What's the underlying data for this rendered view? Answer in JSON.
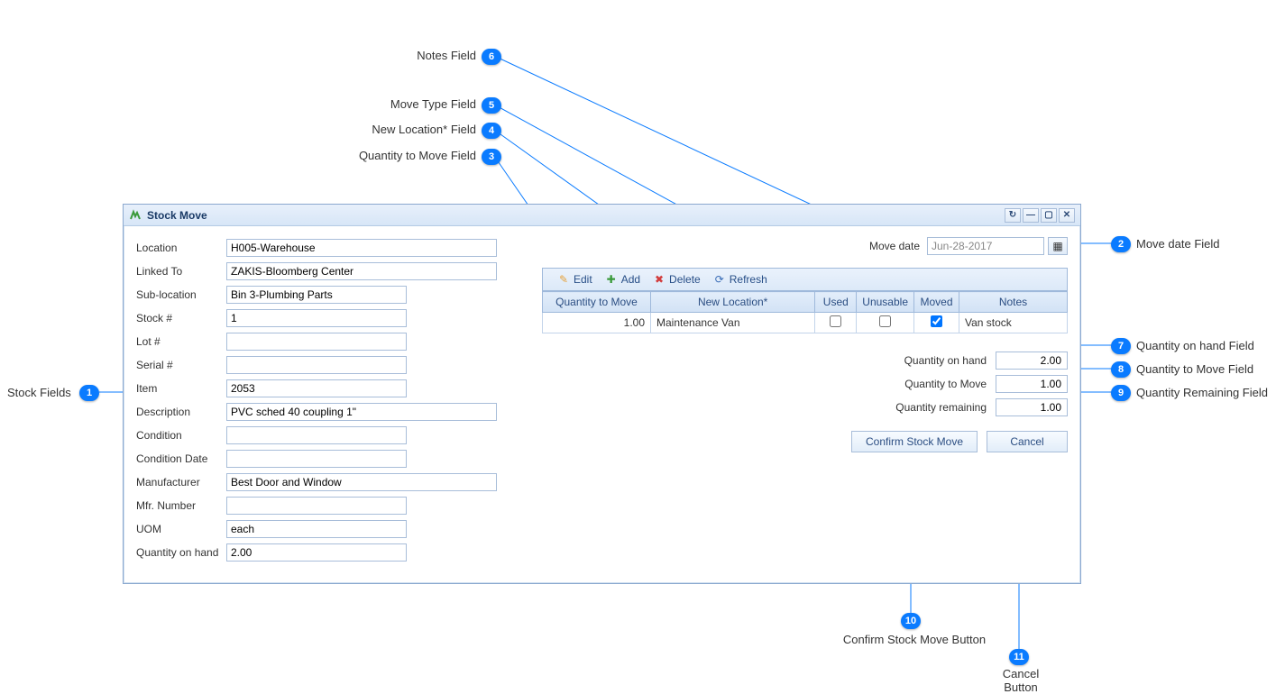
{
  "window": {
    "title": "Stock Move"
  },
  "icons": {
    "refresh": "↻",
    "minimize": "—",
    "maximize": "▢",
    "close": "✕",
    "edit_pencil": "✎",
    "add_plus": "✚",
    "delete_x": "✖",
    "refresh2": "⟳",
    "calendar": "▦"
  },
  "left": {
    "location_label": "Location",
    "location": "H005-Warehouse",
    "linkedto_label": "Linked To",
    "linkedto": "ZAKIS-Bloomberg Center",
    "subloc_label": "Sub-location",
    "subloc": "Bin 3-Plumbing Parts",
    "stock_label": "Stock #",
    "stock": "1",
    "lot_label": "Lot #",
    "lot": "",
    "serial_label": "Serial #",
    "serial": "",
    "item_label": "Item",
    "item": "2053",
    "desc_label": "Description",
    "desc": "PVC sched 40 coupling 1\"",
    "cond_label": "Condition",
    "cond": "",
    "conddate_label": "Condition Date",
    "conddate": "",
    "mfr_label": "Manufacturer",
    "mfr": "Best Door and Window",
    "mfrnum_label": "Mfr. Number",
    "mfrnum": "",
    "uom_label": "UOM",
    "uom": "each",
    "qoh_label": "Quantity on hand",
    "qoh": "2.00"
  },
  "movedate": {
    "label": "Move date",
    "value": "Jun-28-2017"
  },
  "toolbar": {
    "edit": "Edit",
    "add": "Add",
    "delete": "Delete",
    "refresh": "Refresh"
  },
  "grid": {
    "cols": {
      "qty": "Quantity to Move",
      "newloc": "New Location*",
      "used": "Used",
      "unusable": "Unusable",
      "moved": "Moved",
      "notes": "Notes"
    },
    "rows": [
      {
        "qty": "1.00",
        "newloc": "Maintenance Van",
        "used": false,
        "unusable": false,
        "moved": true,
        "notes": "Van stock"
      }
    ]
  },
  "summary": {
    "qoh_label": "Quantity on hand",
    "qoh": "2.00",
    "qtm_label": "Quantity to Move",
    "qtm": "1.00",
    "qrem_label": "Quantity remaining",
    "qrem": "1.00"
  },
  "actions": {
    "confirm": "Confirm Stock Move",
    "cancel": "Cancel"
  },
  "callouts": {
    "c1": "Stock Fields",
    "c2": "Move date Field",
    "c3": "Quantity to Move Field",
    "c4": "New Location* Field",
    "c5": "Move Type Field",
    "c6": "Notes Field",
    "c7": "Quantity on hand Field",
    "c8": "Quantity to Move Field",
    "c9": "Quantity Remaining Field",
    "c10": "Confirm Stock Move Button",
    "c11": "Cancel Button"
  }
}
